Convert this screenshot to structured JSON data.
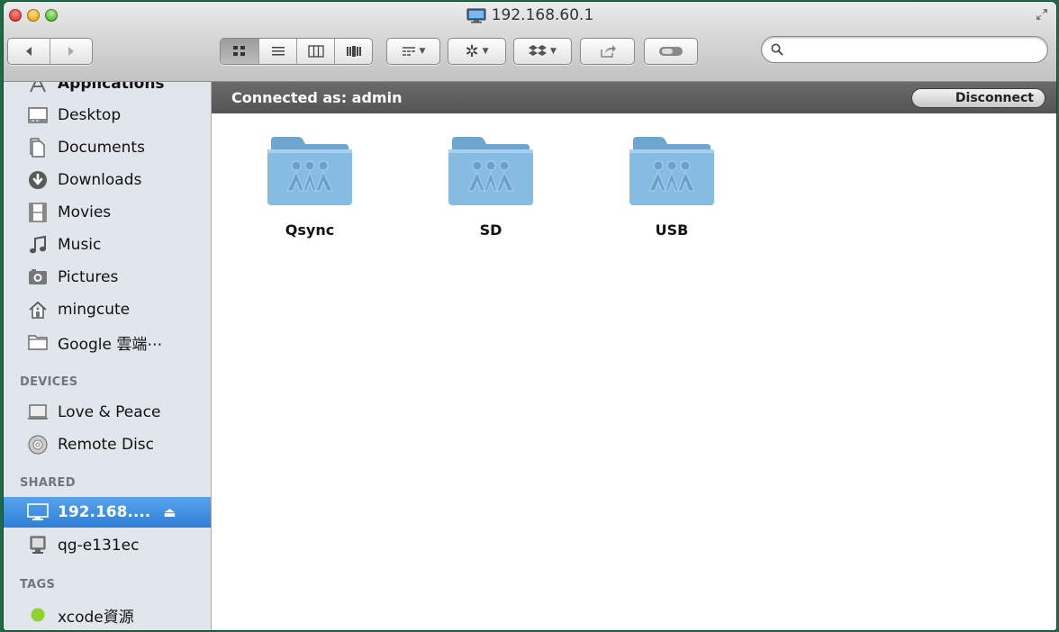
{
  "window": {
    "title": "192.168.60.1"
  },
  "toolbar": {
    "search_placeholder": "",
    "view_buttons": [
      "icon-view",
      "list-view",
      "column-view",
      "cover-flow-view"
    ]
  },
  "sidebar": {
    "partial_item": "Applications",
    "favorites": [
      {
        "label": "Desktop",
        "icon": "desktop-icon"
      },
      {
        "label": "Documents",
        "icon": "documents-icon"
      },
      {
        "label": "Downloads",
        "icon": "downloads-icon"
      },
      {
        "label": "Movies",
        "icon": "movies-icon"
      },
      {
        "label": "Music",
        "icon": "music-icon"
      },
      {
        "label": "Pictures",
        "icon": "pictures-icon"
      },
      {
        "label": "mingcute",
        "icon": "home-icon"
      },
      {
        "label": "Google 雲端⋯",
        "icon": "folder-icon"
      }
    ],
    "devices_header": "DEVICES",
    "devices": [
      {
        "label": "Love & Peace",
        "icon": "laptop-icon"
      },
      {
        "label": "Remote Disc",
        "icon": "disc-icon"
      }
    ],
    "shared_header": "SHARED",
    "shared": [
      {
        "label": "192.168.... ",
        "icon": "monitor-icon",
        "selected": true
      },
      {
        "label": "qg-e131ec",
        "icon": "server-icon",
        "selected": false
      }
    ],
    "tags_header": "TAGS",
    "tags": [
      {
        "label": "xcode資源",
        "color": "#8fd22f"
      }
    ]
  },
  "pathbar": {
    "connected_label": "Connected as: admin",
    "disconnect_label": "Disconnect"
  },
  "folders": [
    {
      "name": "Qsync"
    },
    {
      "name": "SD"
    },
    {
      "name": "USB"
    }
  ],
  "colors": {
    "selection": "#3a8ae0",
    "folder": "#7db3d9",
    "pathbar": "#5e5e5e"
  }
}
